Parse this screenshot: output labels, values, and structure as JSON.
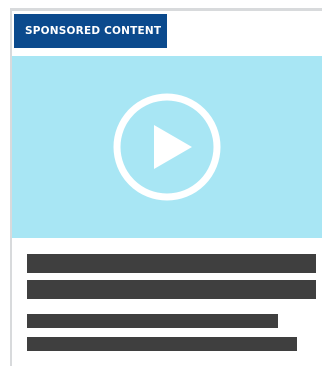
{
  "ad": {
    "badge_label": "SPONSORED CONTENT",
    "video": {
      "background_color": "#a8e6f4",
      "play_icon": "play-icon"
    },
    "colors": {
      "badge": "#0b4a8d",
      "text_placeholder": "#3f3f3f"
    }
  }
}
